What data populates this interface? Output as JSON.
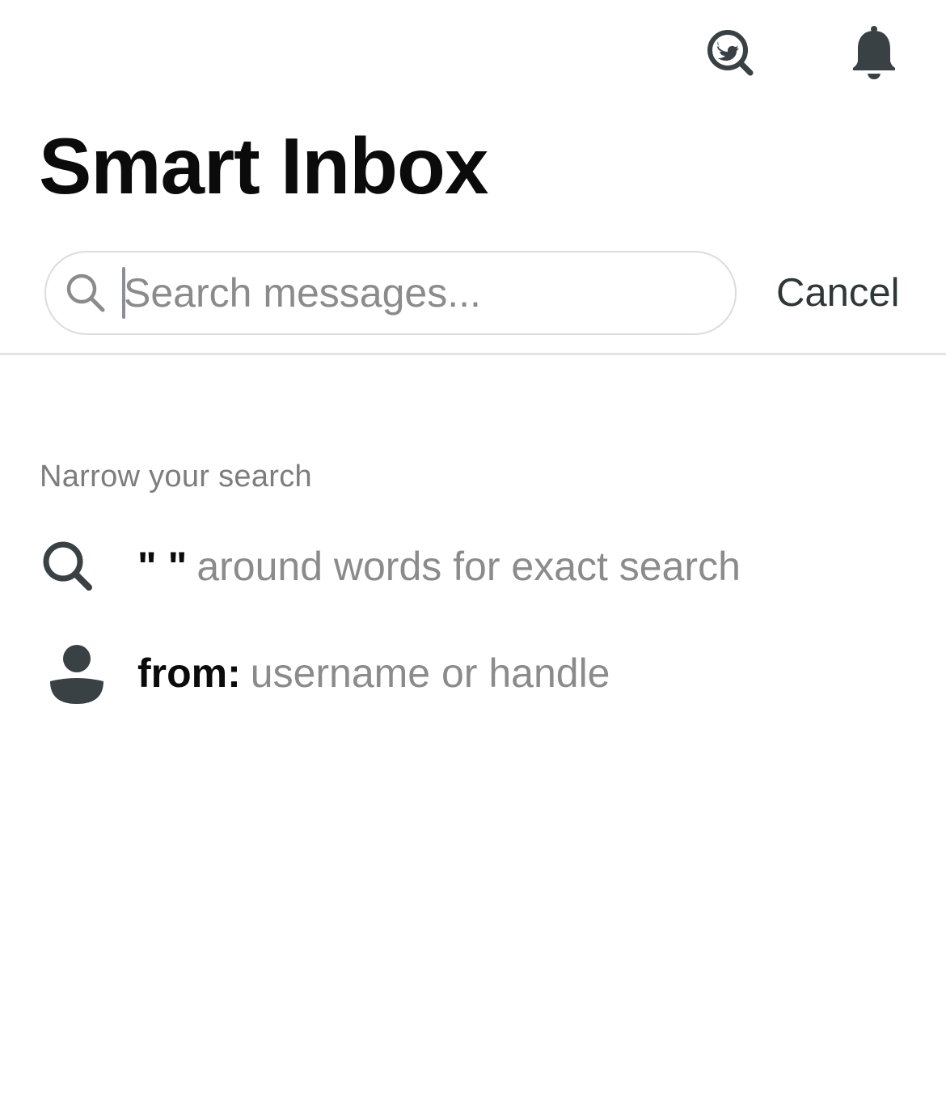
{
  "header": {
    "title": "Smart Inbox",
    "icons": [
      "twitter-search-icon",
      "bell-icon"
    ]
  },
  "search": {
    "placeholder": "Search messages...",
    "value": "",
    "cancel_label": "Cancel"
  },
  "narrow": {
    "label": "Narrow your search",
    "hints": [
      {
        "icon": "search-icon",
        "key": "\" \"",
        "description": "around words for exact search"
      },
      {
        "icon": "person-icon",
        "key": "from:",
        "description": "username or handle"
      }
    ]
  },
  "colors": {
    "icon": "#3a4144",
    "placeholder": "#8b8b8b",
    "border": "#dcdcdc",
    "title": "#0b0b0b"
  }
}
